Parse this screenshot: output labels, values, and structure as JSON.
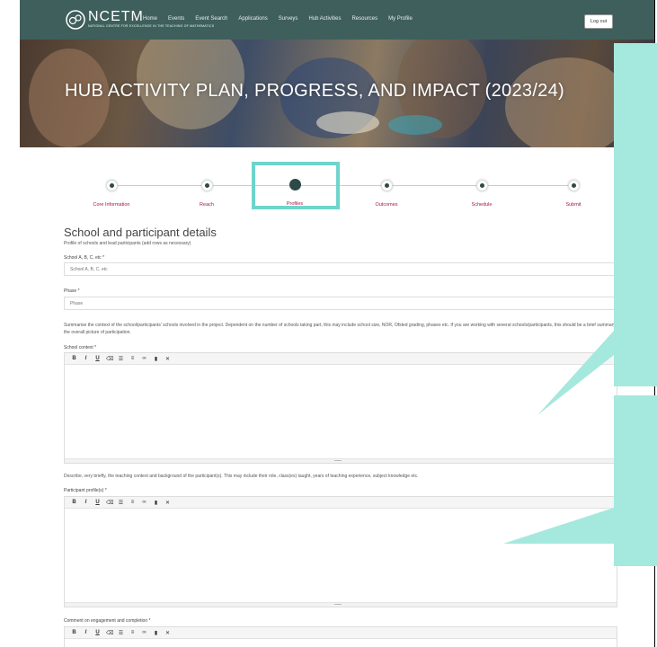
{
  "nav": {
    "logo_text": "NCETM",
    "logo_subtext": "NATIONAL CENTRE FOR EXCELLENCE IN THE TEACHING OF MATHEMATICS",
    "items": [
      "Home",
      "Events",
      "Event Search",
      "Applications",
      "Surveys",
      "Hub Activities",
      "Resources",
      "My Profile"
    ],
    "logout_label": "Log out"
  },
  "hero": {
    "title": "HUB ACTIVITY PLAN, PROGRESS, AND IMPACT (2023/24)"
  },
  "stepper": {
    "steps": [
      "Core Information",
      "Reach",
      "Profiles",
      "Outcomes",
      "Schedule",
      "Submit"
    ],
    "active_index": 2
  },
  "form": {
    "section_title": "School and participant details",
    "section_subtitle": "Profile of schools and lead participants (add rows as necessary)",
    "school_label": "School A, B, C, etc *",
    "school_placeholder": "School A, B, C, etc",
    "phase_label": "Phase *",
    "phase_placeholder": "Phase",
    "context_help": "Summarise the context of the school/participants' schools involved in the project. Dependent on the number of schools taking part, this may include school size, NOR, Ofsted grading, phases etc. If you are working with several schools/participants, this should be a brief summary of the overall picture of participation.",
    "context_label": "School context *",
    "profile_help": "Describe, very briefly, the teaching context and background of the participant(s). This may include their role, class(es) taught, years of teaching experience, subject knowledge etc.",
    "profile_label": "Participant profile(s) *",
    "engagement_label": "Comment on engagement and completion *"
  },
  "toolbar_buttons": [
    "B",
    "I",
    "U",
    "⌫",
    "☰",
    "≡",
    "∞",
    "▮",
    "✕"
  ],
  "colors": {
    "navbar": "#3f5f5c",
    "step_label": "#a8173f",
    "active_step": "#2e4a47",
    "callout": "#a5e8de",
    "highlight": "#6fd4cc"
  }
}
